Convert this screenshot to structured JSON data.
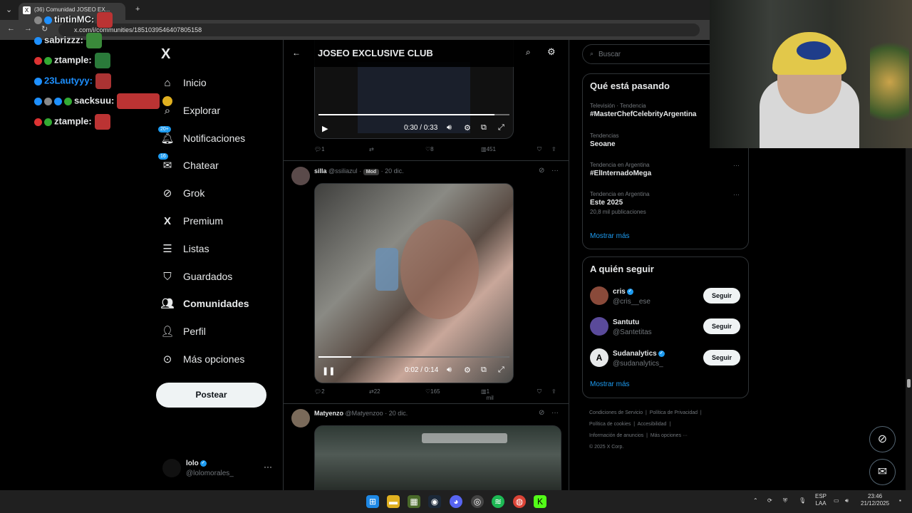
{
  "browser": {
    "tab_title": "(36) Comunidad JOSEO EX...",
    "tab_icon": "X",
    "url": "x.com/i/communities/1851039546407805158"
  },
  "nav": {
    "logo": "X",
    "items": [
      {
        "label": "Inicio",
        "icon": "home-icon"
      },
      {
        "label": "Explorar",
        "icon": "search-icon"
      },
      {
        "label": "Notificaciones",
        "icon": "bell-icon",
        "badge": "20+"
      },
      {
        "label": "Chatear",
        "icon": "mail-icon",
        "badge": "16"
      },
      {
        "label": "Grok",
        "icon": "grok-icon"
      },
      {
        "label": "Premium",
        "icon": "x-icon"
      },
      {
        "label": "Listas",
        "icon": "list-icon"
      },
      {
        "label": "Guardados",
        "icon": "bookmark-icon"
      },
      {
        "label": "Comunidades",
        "icon": "people-icon"
      },
      {
        "label": "Perfil",
        "icon": "person-icon"
      },
      {
        "label": "Más opciones",
        "icon": "more-circle-icon"
      }
    ],
    "post_button": "Postear",
    "account": {
      "name": "lolo",
      "handle": "@lolomorales_"
    }
  },
  "community": {
    "title": "JOSEO EXCLUSIVE CLUB"
  },
  "tweets": [
    {
      "video_time": "0:30 / 0:33",
      "progress": 0.92,
      "replies": "1",
      "retweets": "",
      "likes": "8",
      "views": "451"
    },
    {
      "name": "silla",
      "handle": "@ssiliazul",
      "badge": "Mod",
      "date": "20 dic.",
      "video_time": "0:02 / 0:14",
      "progress": 0.17,
      "replies": "2",
      "retweets": "22",
      "likes": "165",
      "views": "1 mil"
    },
    {
      "name": "Matyenzo",
      "handle": "@Matyenzoo",
      "date": "20 dic."
    }
  ],
  "right": {
    "search_placeholder": "Buscar",
    "trends_title": "Qué está pasando",
    "trends": [
      {
        "context": "Televisión · Tendencia",
        "name": "#MasterChefCelebrityArgentina",
        "count": ""
      },
      {
        "context": "Tendencias",
        "name": "Seoane",
        "count": ""
      },
      {
        "context": "Tendencia en Argentina",
        "name": "#ElInternadoMega",
        "count": ""
      },
      {
        "context": "Tendencia en Argentina",
        "name": "Este 2025",
        "count": "20,8 mil publicaciones"
      }
    ],
    "show_more": "Mostrar más",
    "follow_title": "A quién seguir",
    "follow": [
      {
        "name": "cris",
        "handle": "@cris__ese",
        "verified": true,
        "button": "Seguir"
      },
      {
        "name": "Santutu",
        "handle": "@Santetitas",
        "verified": false,
        "button": "Seguir"
      },
      {
        "name": "Sudanalytics",
        "handle": "@sudanalytics_",
        "verified": true,
        "button": "Seguir"
      }
    ],
    "follow_show_more": "Mostrar más",
    "footer": [
      "Condiciones de Servicio",
      "Política de Privacidad",
      "Política de cookies",
      "Accesibilidad",
      "Información de anuncios",
      "Más opciones ···",
      "© 2025 X Corp."
    ]
  },
  "chat": [
    {
      "user": "tintinMC:",
      "color": "#e7e9ea"
    },
    {
      "user": "sabrizzz:",
      "color": "#e7e9ea"
    },
    {
      "user": "ztample:",
      "color": "#e7e9ea"
    },
    {
      "user": "23Lautyyy:",
      "color": "#1e90ff"
    },
    {
      "user": "sacksuu:",
      "color": "#e7e9ea"
    },
    {
      "user": "ztample:",
      "color": "#e7e9ea"
    }
  ],
  "taskbar": {
    "lang_top": "ESP",
    "lang_bottom": "LAA",
    "time": "23:46",
    "date": "21/12/2025"
  },
  "colors": {
    "accent": "#1d9bf0",
    "background": "#000000",
    "border": "#2f3336",
    "muted": "#71767b"
  }
}
